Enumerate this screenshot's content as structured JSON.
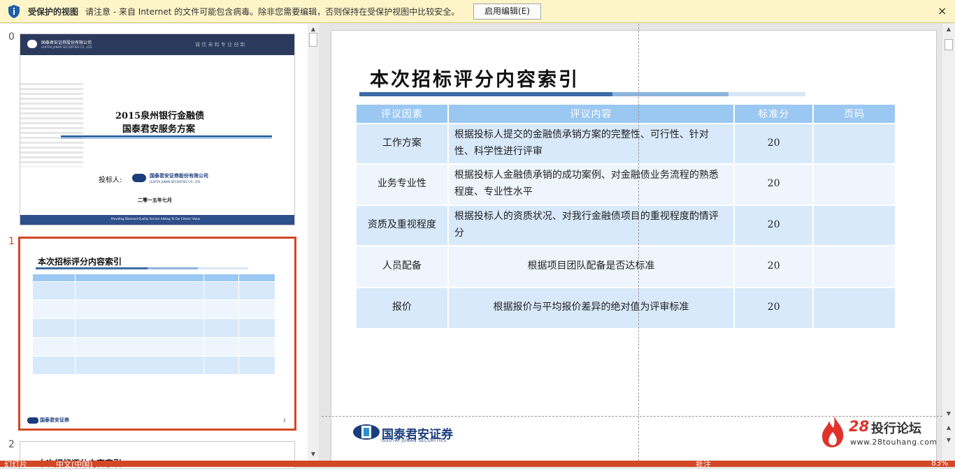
{
  "protected_view": {
    "title": "受保护的视图",
    "message": "请注意 - 来自 Internet 的文件可能包含病毒。除非您需要编辑，否则保持在受保护视图中比较安全。",
    "enable_button": "启用编辑(E)",
    "close_label": "×"
  },
  "thumbnails": {
    "slides": [
      {
        "number": "0",
        "company_cn": "国泰君安证券股份有限公司",
        "company_en": "GUOTAI JUNAN SECURITIES CO., LTD.",
        "motto": "诚 信   未 和   专 业   创 新",
        "title_line1": "2015泉州银行金融债",
        "title_line2": "国泰君安服务方案",
        "bidder_label": "投标人:",
        "bidder_name": "国泰君安证券股份有限公司",
        "bidder_en": "GUOTAI JUNAN SECURITIES CO., LTD.",
        "date": "二零一五年七月",
        "footer": "Providing Diamond Quality Service    Adding To Our Clients' Value"
      },
      {
        "number": "1",
        "title": "本次招标评分内容索引",
        "logo": "国泰君安证券",
        "page": "1"
      },
      {
        "number": "2",
        "title": "本次招标评分内容索引"
      }
    ]
  },
  "slide": {
    "title": "本次招标评分内容索引",
    "headers": [
      "评议因素",
      "评议内容",
      "标准分",
      "页码"
    ],
    "rows": [
      {
        "factor": "工作方案",
        "content": "根据投标人提交的金融债承销方案的完整性、可行性、针对性、科学性进行评审",
        "score": "20",
        "page": ""
      },
      {
        "factor": "业务专业性",
        "content": "根据投标人金融债承销的成功案例、对金融债业务流程的熟悉程度、专业性水平",
        "score": "20",
        "page": ""
      },
      {
        "factor": "资质及重视程度",
        "content": "根据投标人的资质状况、对我行金融债项目的重视程度酌情评分",
        "score": "20",
        "page": ""
      },
      {
        "factor": "人员配备",
        "content": "根据项目团队配备是否达标准",
        "score": "20",
        "page": ""
      },
      {
        "factor": "报价",
        "content": "根据报价与平均报价差异的绝对值为评审标准",
        "score": "20",
        "page": ""
      }
    ],
    "logo_cn": "国泰君安证券",
    "logo_en": "GUOTAI JUNAN SECURITIES"
  },
  "watermark": {
    "number": "28",
    "name": "投行论坛",
    "url": "www.28touhang.com"
  },
  "status_bar": {
    "slide_info": "幻灯片",
    "language": "中文(中国)",
    "notes": "批注",
    "zoom": "83%"
  },
  "colors": {
    "accent": "#d24726",
    "header_blue": "#9bc8f2",
    "row_dark": "#d8e9fb",
    "row_light": "#eef5fd",
    "pv_bar": "#fdf5c8"
  }
}
